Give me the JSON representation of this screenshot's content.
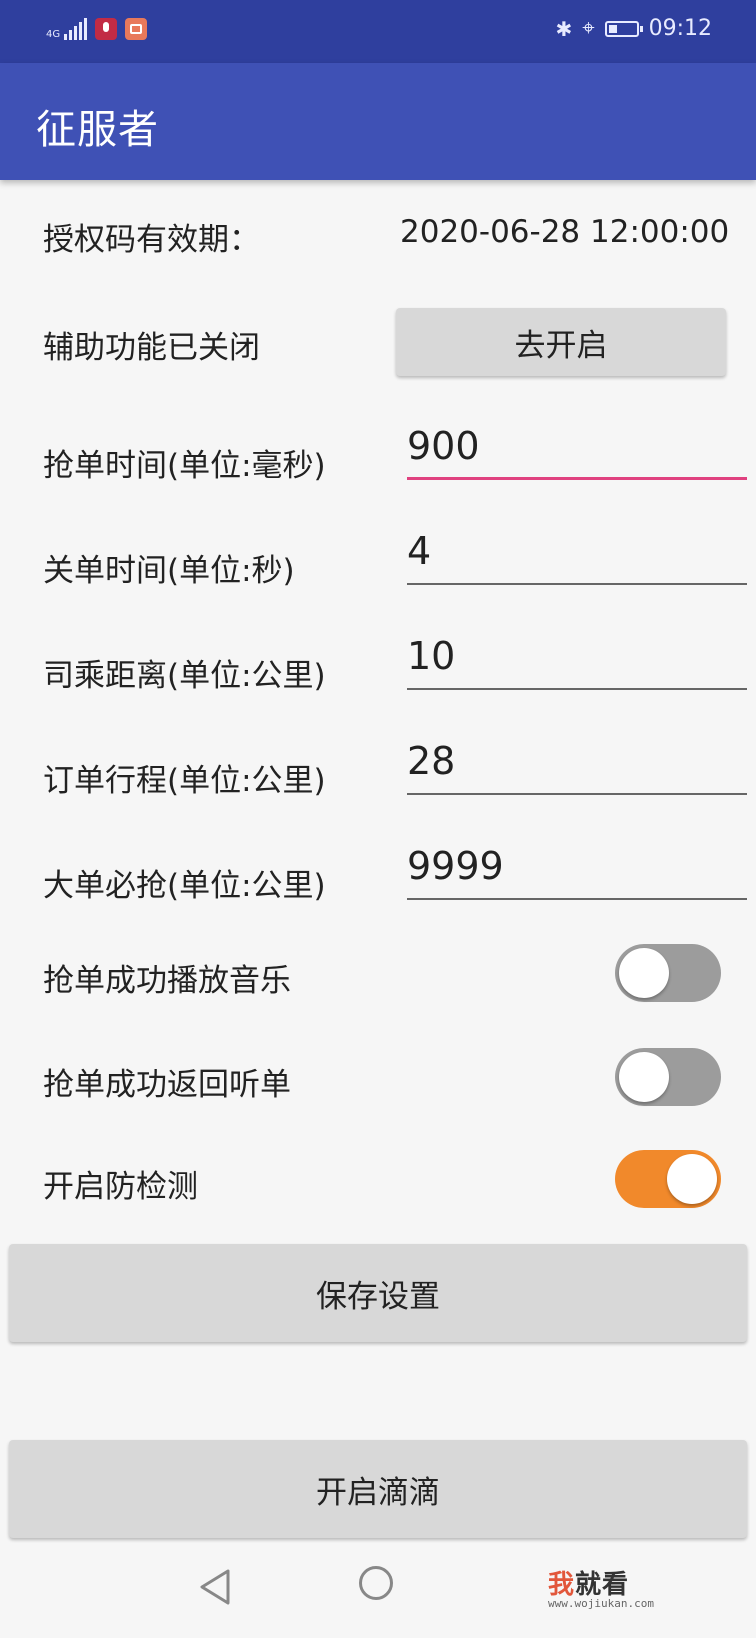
{
  "status_bar": {
    "network": "4G",
    "time": "09:12"
  },
  "app_bar": {
    "title": "征服者"
  },
  "auth": {
    "label": "授权码有效期：",
    "value": "2020-06-28 12:00:00"
  },
  "accessibility": {
    "label": "辅助功能已关闭",
    "button_label": "去开启"
  },
  "fields": {
    "grab_time": {
      "label": "抢单时间(单位:毫秒)",
      "value": "900"
    },
    "close_time": {
      "label": "关单时间(单位:秒)",
      "value": "4"
    },
    "pickup_distance": {
      "label": "司乘距离(单位:公里)",
      "value": "10"
    },
    "trip_distance": {
      "label": "订单行程(单位:公里)",
      "value": "28"
    },
    "big_order": {
      "label": "大单必抢(单位:公里)",
      "value": "9999"
    }
  },
  "toggles": {
    "play_music": {
      "label": "抢单成功播放音乐",
      "on": false
    },
    "return_listen": {
      "label": "抢单成功返回听单",
      "on": false
    },
    "anti_detect": {
      "label": "开启防检测",
      "on": true
    }
  },
  "actions": {
    "save_label": "保存设置",
    "open_didi_label": "开启滴滴"
  },
  "watermark": {
    "text_a": "我",
    "text_b": "就看",
    "url": "www.wojiukan.com"
  },
  "colors": {
    "app_bar": "#3f51b5",
    "status_bar": "#2f3f9e",
    "focus_underline": "#e0417f",
    "switch_on": "#f1892b",
    "switch_off": "#9c9c9c"
  }
}
